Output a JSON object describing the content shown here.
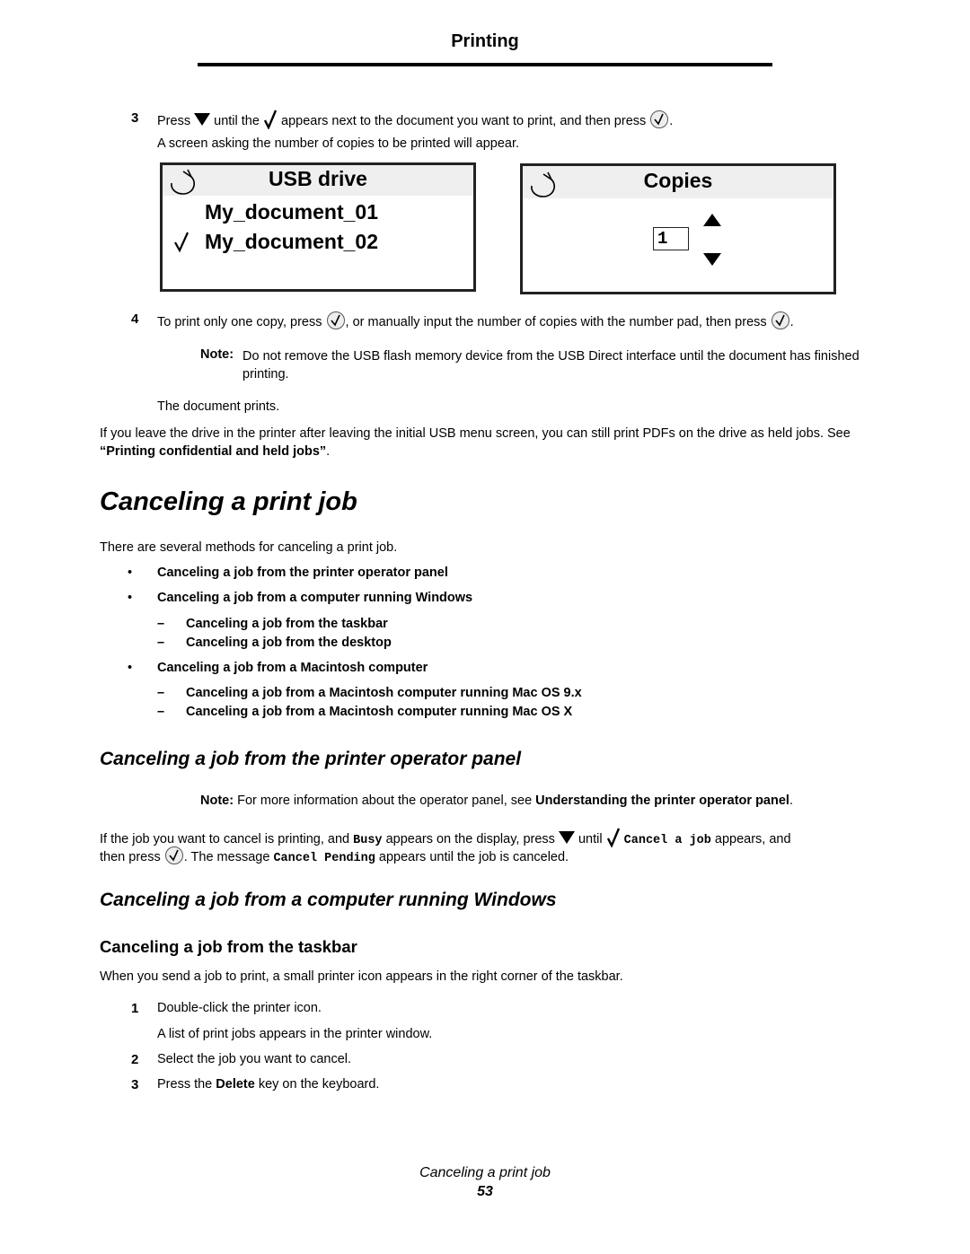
{
  "header": {
    "title": "Printing"
  },
  "step3": {
    "num": "3",
    "text_a": "Press",
    "text_b": "until the",
    "text_c": "appears next to the document you want to print, and then press",
    "text_d": ".",
    "result": "A screen asking the number of copies to be printed will appear."
  },
  "usb_panel": {
    "title": "USB drive",
    "items": [
      {
        "label": "My_document_01",
        "selected": false
      },
      {
        "label": "My_document_02",
        "selected": true
      }
    ]
  },
  "copies_panel": {
    "title": "Copies",
    "value": "1"
  },
  "step4": {
    "num": "4",
    "text_a": "To print only one copy, press",
    "text_b": ", or manually input the number of copies with the number pad, then press",
    "text_c": "."
  },
  "note1": {
    "label": "Note:",
    "text": "Do not remove the USB flash memory device from the USB Direct interface until the document has finished printing."
  },
  "doc_prints": "The document prints.",
  "held_jobs": {
    "text": "If you leave the drive in the printer after leaving the initial USB menu screen, you can still print PDFs on the drive as held jobs. See ",
    "link": "“Printing confidential and held jobs”",
    "end": "."
  },
  "section_title": "Canceling a print job",
  "intro": "There are several methods for canceling a print job.",
  "methods": [
    {
      "label": "Canceling a job from the printer operator panel",
      "sub": []
    },
    {
      "label": "Canceling a job from a computer running Windows",
      "sub": [
        "Canceling a job from the taskbar",
        "Canceling a job from the desktop"
      ]
    },
    {
      "label": "Canceling a job from a Macintosh computer",
      "sub": [
        "Canceling a job from a Macintosh computer running Mac OS 9.x",
        "Canceling a job from a Macintosh computer running Mac OS X"
      ]
    }
  ],
  "operator_panel": {
    "heading": "Canceling a job from the printer operator panel",
    "note_label": "Note:",
    "note_text": "For more information about the operator panel, see ",
    "note_link": "Understanding the printer operator panel",
    "note_end": ".",
    "p_a": "If the job you want to cancel is printing, and",
    "busy": "Busy",
    "p_b": "appears on the display, press",
    "p_c": "until",
    "cancel_job": "Cancel a job",
    "p_d": "appears, and",
    "p_e": "then press",
    "p_f": ". The message",
    "cancel_pending": "Cancel Pending",
    "p_g": "appears until the job is canceled."
  },
  "windows": {
    "heading": "Canceling a job from a computer running Windows",
    "taskbar_heading": "Canceling a job from the taskbar",
    "taskbar_intro": "When you send a job to print, a small printer icon appears in the right corner of the taskbar.",
    "steps": [
      {
        "num": "1",
        "text": "Double-click the printer icon."
      },
      {
        "num": "2",
        "text": "Select the job you want to cancel."
      },
      {
        "num": "3",
        "text_a": "Press the",
        "bold": "Delete",
        "text_b": "key on the keyboard."
      }
    ],
    "step1_result": "A list of print jobs appears in the printer window."
  },
  "footer": {
    "section": "Canceling a print job",
    "page": "53"
  }
}
